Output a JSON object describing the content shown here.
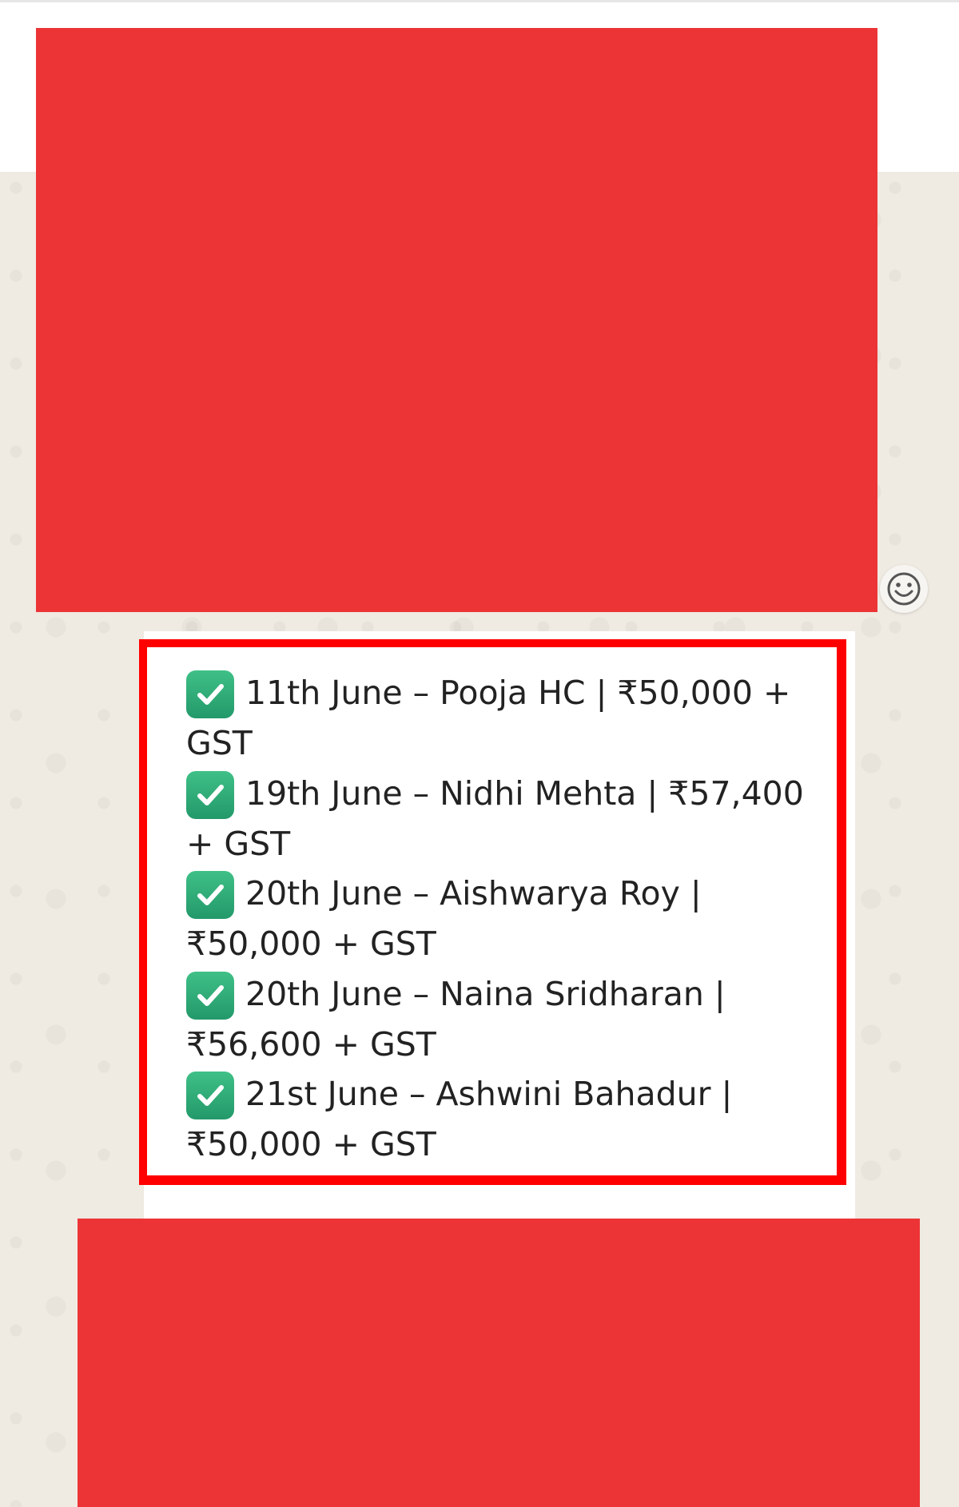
{
  "colors": {
    "redaction": "#ec3436",
    "highlight_border": "#ff0000",
    "chat_background": "#efeae2",
    "check_icon": "#2fab78"
  },
  "message": {
    "items": [
      {
        "icon": "check-mark-button-icon",
        "text": "11th June – Pooja HC | ₹50,000 + GST"
      },
      {
        "icon": "check-mark-button-icon",
        "text": "19th June – Nidhi Mehta | ₹57,400 + GST"
      },
      {
        "icon": "check-mark-button-icon",
        "text": "20th June – Aishwarya Roy | ₹50,000 + GST"
      },
      {
        "icon": "check-mark-button-icon",
        "text": "20th June – Naina Sridharan | ₹56,600 + GST"
      },
      {
        "icon": "check-mark-button-icon",
        "text": "21st June – Ashwini Bahadur | ₹50,000 + GST"
      }
    ]
  },
  "reaction_button": {
    "icon": "smiley-face-icon"
  }
}
